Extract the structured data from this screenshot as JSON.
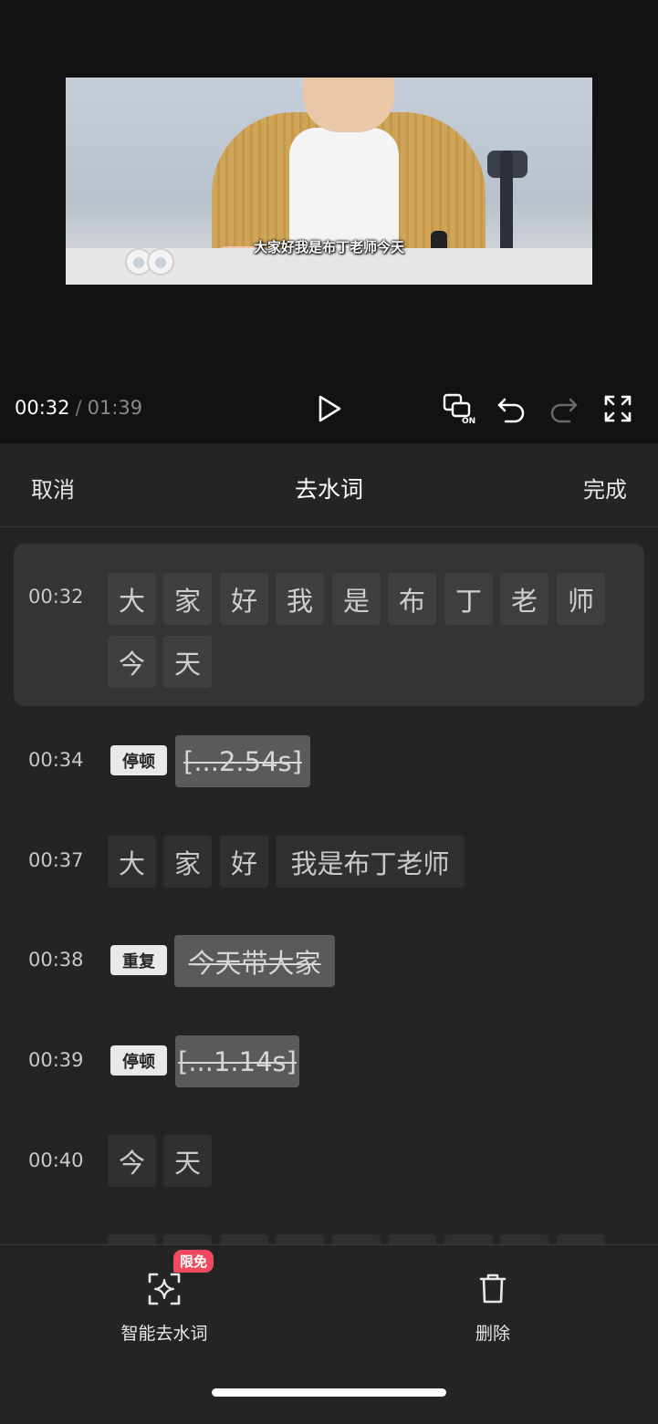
{
  "player": {
    "current_time": "00:32",
    "separator": "/",
    "total_time": "01:39",
    "subtitle": "大家好我是布丁老师今天",
    "icons": [
      "play-icon",
      "caption-on-icon",
      "undo-icon",
      "redo-icon",
      "fullscreen-icon"
    ],
    "caption_toggle_text": "ON"
  },
  "header": {
    "cancel": "取消",
    "title": "去水词",
    "done": "完成"
  },
  "rows": [
    {
      "time": "00:32",
      "words": [
        "大",
        "家",
        "好",
        "我",
        "是",
        "布",
        "丁",
        "老",
        "师",
        "今",
        "天"
      ]
    },
    {
      "time": "00:34",
      "tag": "停顿",
      "struck": "[...2.54s]"
    },
    {
      "time": "00:37",
      "words": [
        "大",
        "家",
        "好",
        "我是布丁老师"
      ]
    },
    {
      "time": "00:38",
      "tag": "重复",
      "struck": "今天带大家"
    },
    {
      "time": "00:39",
      "tag": "停顿",
      "struck": "[...1.14s]"
    },
    {
      "time": "00:40",
      "words": [
        "今",
        "天"
      ]
    }
  ],
  "toolbar": {
    "smart_remove": {
      "label": "智能去水词",
      "badge": "限免",
      "icon": "sparkle-frame-icon"
    },
    "delete": {
      "label": "删除",
      "icon": "trash-icon"
    }
  },
  "colors": {
    "accent_badge": "#ef4a5f",
    "panel_bg": "#242424",
    "highlight_row": "#343434"
  }
}
